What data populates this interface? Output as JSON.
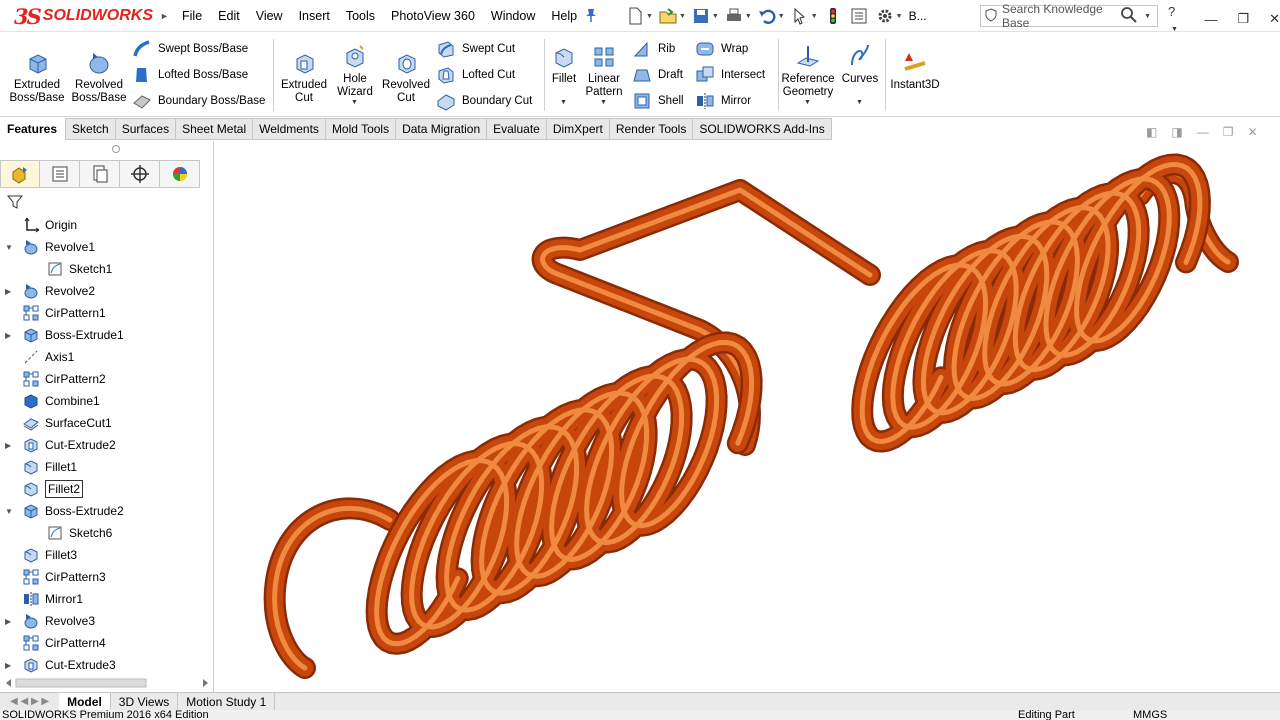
{
  "app": {
    "logo_text": "SOLIDWORKS"
  },
  "menu": [
    "File",
    "Edit",
    "View",
    "Insert",
    "Tools",
    "PhotoView 360",
    "Window",
    "Help"
  ],
  "quick_access": {
    "overflow_label": "B..."
  },
  "search": {
    "placeholder": "Search Knowledge Base"
  },
  "ribbon": {
    "extruded_boss": "Extruded Boss/Base",
    "revolved_boss": "Revolved Boss/Base",
    "swept_boss": "Swept Boss/Base",
    "lofted_boss": "Lofted Boss/Base",
    "boundary_boss": "Boundary Boss/Base",
    "extruded_cut": "Extruded Cut",
    "hole_wizard": "Hole Wizard",
    "revolved_cut": "Revolved Cut",
    "swept_cut": "Swept Cut",
    "lofted_cut": "Lofted Cut",
    "boundary_cut": "Boundary Cut",
    "fillet": "Fillet",
    "linear_pattern": "Linear Pattern",
    "rib": "Rib",
    "draft": "Draft",
    "shell": "Shell",
    "wrap": "Wrap",
    "intersect": "Intersect",
    "mirror": "Mirror",
    "reference_geometry": "Reference Geometry",
    "curves": "Curves",
    "instant3d": "Instant3D"
  },
  "tabs": [
    "Features",
    "Sketch",
    "Surfaces",
    "Sheet Metal",
    "Weldments",
    "Mold Tools",
    "Data Migration",
    "Evaluate",
    "DimXpert",
    "Render Tools",
    "SOLIDWORKS Add-Ins"
  ],
  "active_tab": "Features",
  "tree": [
    {
      "label": "Origin",
      "icon": "origin-icon",
      "level": 1,
      "expander": ""
    },
    {
      "label": "Revolve1",
      "icon": "revolve-feature-icon",
      "level": 1,
      "expander": "expanded"
    },
    {
      "label": "Sketch1",
      "icon": "sketch-icon",
      "level": 2,
      "expander": ""
    },
    {
      "label": "Revolve2",
      "icon": "revolve-feature-icon",
      "level": 1,
      "expander": "collapsed"
    },
    {
      "label": "CirPattern1",
      "icon": "circular-pattern-icon",
      "level": 1,
      "expander": ""
    },
    {
      "label": "Boss-Extrude1",
      "icon": "extrude-feature-icon",
      "level": 1,
      "expander": "collapsed"
    },
    {
      "label": "Axis1",
      "icon": "axis-icon",
      "level": 1,
      "expander": ""
    },
    {
      "label": "CirPattern2",
      "icon": "circular-pattern-icon",
      "level": 1,
      "expander": ""
    },
    {
      "label": "Combine1",
      "icon": "combine-icon",
      "level": 1,
      "expander": ""
    },
    {
      "label": "SurfaceCut1",
      "icon": "surface-cut-icon",
      "level": 1,
      "expander": ""
    },
    {
      "label": "Cut-Extrude2",
      "icon": "cut-extrude-icon",
      "level": 1,
      "expander": "collapsed"
    },
    {
      "label": "Fillet1",
      "icon": "fillet-feature-icon",
      "level": 1,
      "expander": ""
    },
    {
      "label": "Fillet2",
      "icon": "fillet-feature-icon",
      "level": 1,
      "expander": "",
      "selected": true
    },
    {
      "label": "Boss-Extrude2",
      "icon": "extrude-feature-icon",
      "level": 1,
      "expander": "expanded"
    },
    {
      "label": "Sketch6",
      "icon": "sketch-icon",
      "level": 2,
      "expander": ""
    },
    {
      "label": "Fillet3",
      "icon": "fillet-feature-icon",
      "level": 1,
      "expander": ""
    },
    {
      "label": "CirPattern3",
      "icon": "circular-pattern-icon",
      "level": 1,
      "expander": ""
    },
    {
      "label": "Mirror1",
      "icon": "mirror-feature-icon",
      "level": 1,
      "expander": ""
    },
    {
      "label": "Revolve3",
      "icon": "revolve-feature-icon",
      "level": 1,
      "expander": "collapsed"
    },
    {
      "label": "CirPattern4",
      "icon": "circular-pattern-icon",
      "level": 1,
      "expander": ""
    },
    {
      "label": "Cut-Extrude3",
      "icon": "cut-extrude-icon",
      "level": 1,
      "expander": "collapsed"
    }
  ],
  "bottom_tabs": [
    "Model",
    "3D Views",
    "Motion Study 1"
  ],
  "active_bottom_tab": "Model",
  "status": {
    "left": "SOLIDWORKS Premium 2016 x64 Edition",
    "editing": "Editing Part",
    "units": "MMGS"
  },
  "colors": {
    "spring": "#c6460c",
    "brand": "#e2231a",
    "icon_blue": "#2a70c8"
  }
}
